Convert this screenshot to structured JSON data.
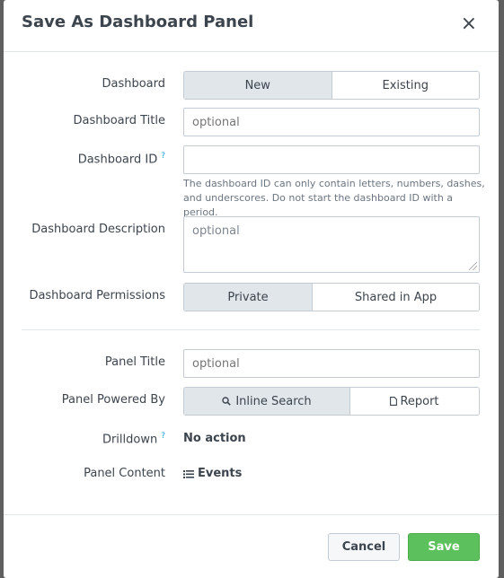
{
  "dialog": {
    "title": "Save As Dashboard Panel",
    "close_glyph": "×"
  },
  "form": {
    "dashboard": {
      "label": "Dashboard",
      "options": [
        "New",
        "Existing"
      ],
      "selected": "New"
    },
    "dashboard_title": {
      "label": "Dashboard Title",
      "placeholder": "optional",
      "value": ""
    },
    "dashboard_id": {
      "label": "Dashboard ID",
      "help_glyph": "?",
      "value": "",
      "hint": "The dashboard ID can only contain letters, numbers, dashes, and underscores. Do not start the dashboard ID with a period."
    },
    "dashboard_description": {
      "label": "Dashboard Description",
      "placeholder": "optional",
      "value": ""
    },
    "dashboard_permissions": {
      "label": "Dashboard Permissions",
      "options": [
        "Private",
        "Shared in App"
      ],
      "selected": "Private"
    },
    "panel_title": {
      "label": "Panel Title",
      "placeholder": "optional",
      "value": ""
    },
    "panel_powered_by": {
      "label": "Panel Powered By",
      "options": [
        "Inline Search",
        "Report"
      ],
      "option_icons": [
        "search-icon",
        "document-icon"
      ],
      "selected": "Inline Search"
    },
    "drilldown": {
      "label": "Drilldown",
      "help_glyph": "?",
      "value": "No action"
    },
    "panel_content": {
      "label": "Panel Content",
      "icon": "list-icon",
      "value": "Events"
    }
  },
  "footer": {
    "cancel_label": "Cancel",
    "save_label": "Save"
  },
  "colors": {
    "save_button": "#5cc05c",
    "help_mark": "#1a9fd8",
    "active_segment": "#e1e6eb"
  }
}
